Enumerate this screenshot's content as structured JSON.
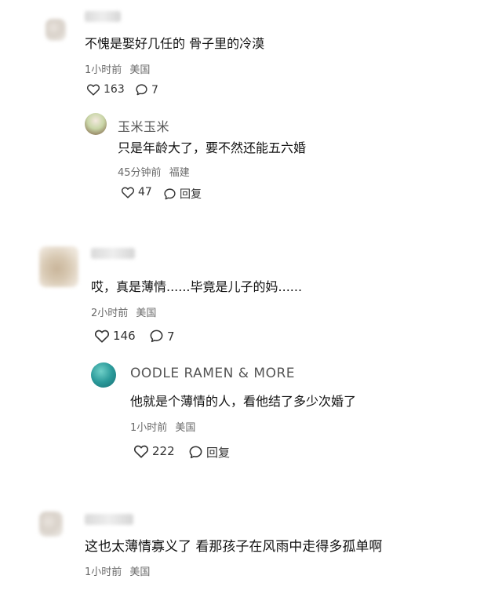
{
  "comments": [
    {
      "text": "不愧是娶好几任的 骨子里的冷漠",
      "time": "1小时前",
      "location": "美国",
      "likes": "163",
      "replies": "7",
      "reply": {
        "username": "玉米玉米",
        "text": "只是年龄大了，要不然还能五六婚",
        "time": "45分钟前",
        "location": "福建",
        "likes": "47",
        "reply_label": "回复"
      }
    },
    {
      "text": "哎，真是薄情......毕竟是儿子的妈......",
      "time": "2小时前",
      "location": "美国",
      "likes": "146",
      "replies": "7",
      "reply": {
        "username": "OODLE RAMEN & MORE",
        "text": "他就是个薄情的人，看他结了多少次婚了",
        "time": "1小时前",
        "location": "美国",
        "likes": "222",
        "reply_label": "回复"
      }
    },
    {
      "text": "这也太薄情寡义了 看那孩子在风雨中走得多孤单啊",
      "time": "1小时前",
      "location": "美国"
    }
  ],
  "colors": {
    "text": "#111111",
    "meta": "#6a6a6a",
    "reply_avatar_1": "#c7d3b0",
    "reply_avatar_2": "#2b9a9a"
  },
  "icons": [
    "heart-icon",
    "comment-bubble-icon"
  ]
}
